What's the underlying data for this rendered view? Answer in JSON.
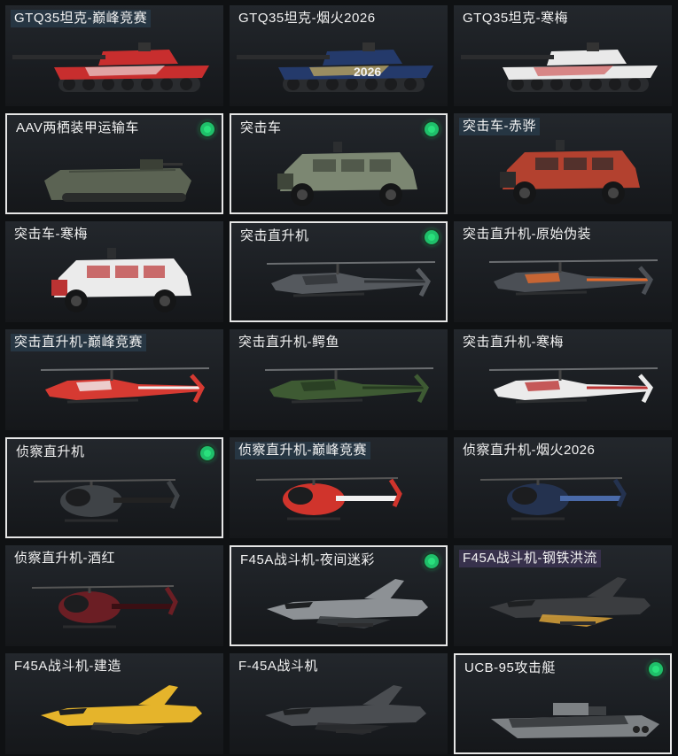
{
  "vehicles": [
    {
      "label": "GTQ35坦克-巅峰竞赛",
      "owned": false,
      "art": "tank",
      "color": "#c82e2e",
      "accent": "#f2f2f2",
      "label_style": "hl"
    },
    {
      "label": "GTQ35坦克-烟火2026",
      "owned": false,
      "art": "tank",
      "color": "#243a6b",
      "accent": "#e9c45a",
      "badge": "2026",
      "label_style": "none"
    },
    {
      "label": "GTQ35坦克-寒梅",
      "owned": false,
      "art": "tank",
      "color": "#e9e9e9",
      "accent": "#c44",
      "label_style": "none"
    },
    {
      "label": "AAV两栖装甲运输车",
      "owned": true,
      "art": "aav",
      "color": "#5b6353",
      "accent": "#3b4036",
      "label_style": "none"
    },
    {
      "label": "突击车",
      "owned": true,
      "art": "truck",
      "color": "#7c8772",
      "accent": "#3f463a",
      "label_style": "none"
    },
    {
      "label": "突击车-赤骅",
      "owned": false,
      "art": "truck",
      "color": "#b3412f",
      "accent": "#2b2b2b",
      "label_style": "hl"
    },
    {
      "label": "突击车-寒梅",
      "owned": false,
      "art": "truck",
      "color": "#ebebeb",
      "accent": "#b33",
      "label_style": "none"
    },
    {
      "label": "突击直升机",
      "owned": true,
      "art": "heli",
      "color": "#55595e",
      "accent": "#2f3236",
      "label_style": "none"
    },
    {
      "label": "突击直升机-原始伪装",
      "owned": false,
      "art": "heli",
      "color": "#4b4f55",
      "accent": "#e56a2c",
      "label_style": "none"
    },
    {
      "label": "突击直升机-巅峰竞赛",
      "owned": false,
      "art": "heli",
      "color": "#d63a32",
      "accent": "#f1f1f1",
      "label_style": "hl"
    },
    {
      "label": "突击直升机-鳄鱼",
      "owned": false,
      "art": "heli",
      "color": "#3e5a33",
      "accent": "#263a20",
      "label_style": "none"
    },
    {
      "label": "突击直升机-寒梅",
      "owned": false,
      "art": "heli",
      "color": "#ebebeb",
      "accent": "#b33",
      "label_style": "none"
    },
    {
      "label": "侦察直升机",
      "owned": true,
      "art": "scout",
      "color": "#3f4347",
      "accent": "#222",
      "label_style": "none"
    },
    {
      "label": "侦察直升机-巅峰竞赛",
      "owned": false,
      "art": "scout",
      "color": "#d0342c",
      "accent": "#f1f1f1",
      "label_style": "hl"
    },
    {
      "label": "侦察直升机-烟火2026",
      "owned": false,
      "art": "scout",
      "color": "#24324f",
      "accent": "#4a6aa8",
      "label_style": "none"
    },
    {
      "label": "侦察直升机-酒红",
      "owned": false,
      "art": "scout",
      "color": "#6b1e24",
      "accent": "#3a0f13",
      "label_style": "none"
    },
    {
      "label": "F45A战斗机-夜间迷彩",
      "owned": true,
      "art": "jet",
      "color": "#8d9195",
      "accent": "#3a3d41",
      "label_style": "none"
    },
    {
      "label": "F45A战斗机-钢铁洪流",
      "owned": false,
      "art": "jet",
      "color": "#3b3d40",
      "accent": "#d9a23a",
      "label_style": "hl-purple"
    },
    {
      "label": "F45A战斗机-建造",
      "owned": false,
      "art": "jet",
      "color": "#e5b42b",
      "accent": "#333",
      "label_style": "none"
    },
    {
      "label": "F-45A战斗机",
      "owned": false,
      "art": "jet",
      "color": "#4a4d51",
      "accent": "#2b2d30",
      "label_style": "none"
    },
    {
      "label": "UCB-95攻击艇",
      "owned": true,
      "art": "boat",
      "color": "#7d8184",
      "accent": "#3d4043",
      "label_style": "none"
    }
  ]
}
